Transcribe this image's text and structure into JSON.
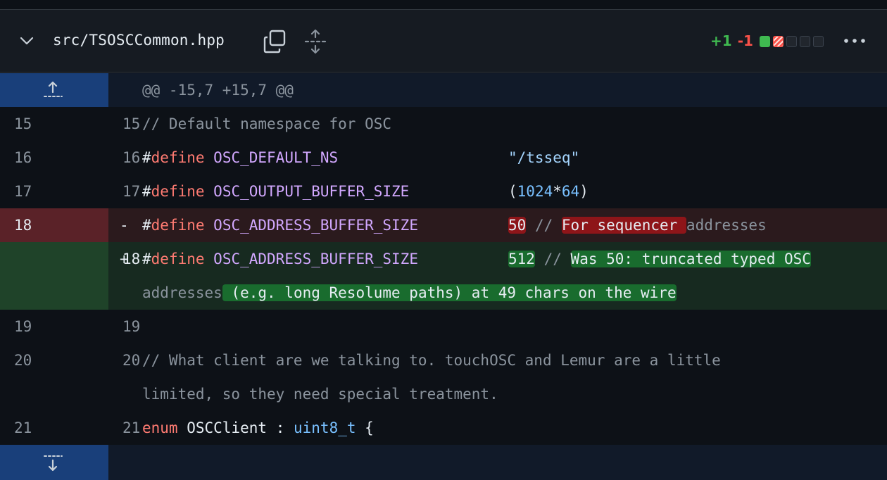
{
  "file": {
    "name": "src/TSOSCCommon.hpp",
    "additions": "+1",
    "deletions": "-1",
    "stat_blocks": [
      "added",
      "removed",
      "neutral",
      "neutral",
      "neutral"
    ],
    "icons": [
      "chevron-down-icon",
      "copy-icon",
      "unfold-icon",
      "kebab-horizontal-icon"
    ]
  },
  "hunk": {
    "header": "@@ -15,7 +15,7 @@"
  },
  "lines": {
    "l15": {
      "old": "15",
      "new": "15",
      "text": "// Default namespace for OSC"
    },
    "l16": {
      "old": "16",
      "new": "16",
      "hash": "#",
      "kw": "define",
      "macro": "OSC_DEFAULT_NS",
      "value": "\"/tsseq\""
    },
    "l17": {
      "old": "17",
      "new": "17",
      "hash": "#",
      "kw": "define",
      "macro": "OSC_OUTPUT_BUFFER_SIZE",
      "paren_open": "(",
      "num1": "1024",
      "op": "*",
      "num2": "64",
      "paren_close": ")"
    },
    "l18del": {
      "old": "18",
      "sign": "-",
      "hash": "#",
      "kw": "define",
      "macro": "OSC_ADDRESS_BUFFER_SIZE",
      "value": "50",
      "comment_start": "//",
      "changed": "For sequencer ",
      "rest": "addresses"
    },
    "l18add": {
      "new": "18",
      "sign": "+",
      "hash": "#",
      "kw": "define",
      "macro": "OSC_ADDRESS_BUFFER_SIZE",
      "value": "512",
      "comment_start": "//",
      "changed1": "Was 50: truncated typed OSC",
      "wrap_plain": "addresses",
      "changed2": " (e.g. long Resolume paths) at 49 chars on the wire"
    },
    "l19": {
      "old": "19",
      "new": "19",
      "text": ""
    },
    "l20": {
      "old": "20",
      "new": "20",
      "text1": "// What client are we talking to. touchOSC and Lemur are a little",
      "text2": "limited, so they need special treatment."
    },
    "l21": {
      "old": "21",
      "new": "21",
      "kw": "enum",
      "name": "OSCClient",
      "colon": ":",
      "type": "uint8_t",
      "brace": "{"
    }
  },
  "colors": {
    "added": "#3fb950",
    "removed": "#f85149",
    "added_highlight": "#196c2e",
    "removed_highlight": "#8e1519",
    "expander": "#193f7a"
  }
}
